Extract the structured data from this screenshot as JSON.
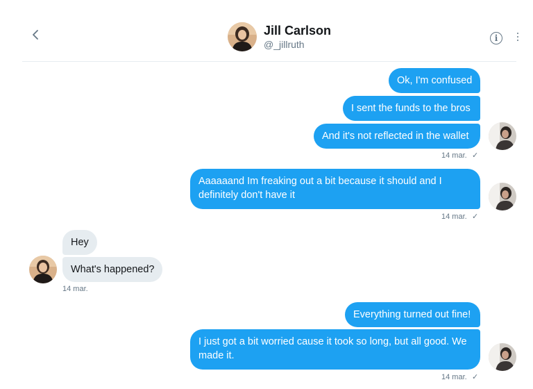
{
  "header": {
    "name": "Jill Carlson",
    "handle": "@_jillruth",
    "back_icon": "chevron-left-icon",
    "info_icon": "info-icon",
    "info_glyph": "i"
  },
  "messages": [
    {
      "id": "m1",
      "direction": "out",
      "text": "Ok, I'm confused"
    },
    {
      "id": "m2",
      "direction": "out",
      "text": "I sent the funds to the bros"
    },
    {
      "id": "m3",
      "direction": "out",
      "text": "And it's not reflected in the wallet"
    },
    {
      "id": "m4",
      "direction": "out",
      "text": "Aaaaaand Im freaking out a bit because it should and I definitely don't have it"
    },
    {
      "id": "m5",
      "direction": "in",
      "text": "Hey"
    },
    {
      "id": "m6",
      "direction": "in",
      "text": "What's happened?"
    },
    {
      "id": "m7",
      "direction": "out",
      "text": "Everything turned out fine!"
    },
    {
      "id": "m8",
      "direction": "out",
      "text": "I just got a bit worried cause it took so long, but all good. We made it."
    }
  ],
  "timestamps": {
    "t1": "14 mar.",
    "t2": "14 mar.",
    "t3": "14 mar.",
    "t4": "14 mar."
  },
  "read_mark": "✓",
  "colors": {
    "outgoing_bubble": "#1da1f2",
    "incoming_bubble": "#e6ecf0",
    "secondary_text": "#657786"
  }
}
